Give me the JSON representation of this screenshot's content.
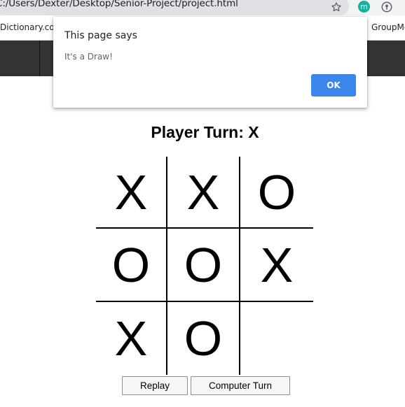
{
  "browser": {
    "url": "C:/Users/Dexter/Desktop/Senior-Project/project.html",
    "extension_letter": "m",
    "bookmarks": [
      "Dictionary.com",
      "GroupMe"
    ],
    "colors": {
      "extension": "#16b39a"
    }
  },
  "dialog": {
    "title": "This page says",
    "message": "It's a Draw!",
    "ok_label": "OK",
    "colors": {
      "ok_button": "#3b86ea"
    }
  },
  "game": {
    "turn_label": "Player Turn: X",
    "board": [
      [
        "X",
        "X",
        "O"
      ],
      [
        "O",
        "O",
        "X"
      ],
      [
        "X",
        "O",
        ""
      ]
    ],
    "buttons": {
      "replay": "Replay",
      "computer_turn": "Computer Turn"
    }
  },
  "colors": {
    "navbar": "#333333"
  }
}
